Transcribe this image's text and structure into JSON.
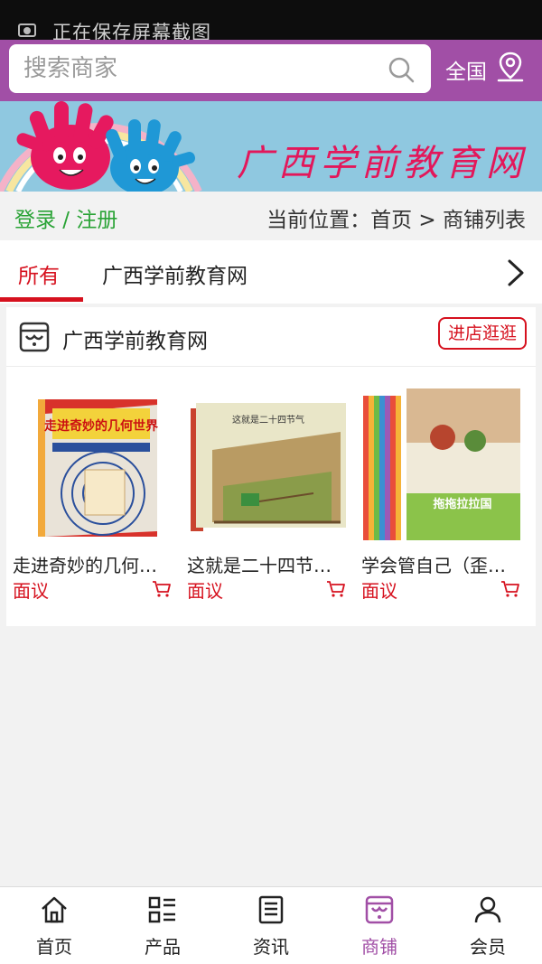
{
  "status_bar": {
    "message": "正在保存屏幕截图"
  },
  "search": {
    "placeholder": "搜索商家",
    "region_label": "全国"
  },
  "banner": {
    "title": "广西学前教育网"
  },
  "auth": {
    "login": "登录",
    "separator": " / ",
    "register": "注册"
  },
  "breadcrumb": "当前位置：首页 > 商铺列表",
  "tabs": [
    {
      "label": "所有",
      "active": true
    },
    {
      "label": "广西学前教育网",
      "active": false
    }
  ],
  "shop": {
    "name": "广西学前教育网",
    "visit_label": "进店逛逛",
    "products": [
      {
        "name": "走进奇妙的几何…",
        "price": "面议",
        "cover_title": "走进奇妙的几何世界"
      },
      {
        "name": "这就是二十四节…",
        "price": "面议",
        "cover_title": "这就是二十四节气"
      },
      {
        "name": "学会管自己（歪…",
        "price": "面议",
        "cover_title": "拖拖拉拉国"
      }
    ]
  },
  "bottom_nav": [
    {
      "label": "首页",
      "icon": "home-icon",
      "active": false
    },
    {
      "label": "产品",
      "icon": "grid-list-icon",
      "active": false
    },
    {
      "label": "资讯",
      "icon": "news-icon",
      "active": false
    },
    {
      "label": "商铺",
      "icon": "store-icon",
      "active": true
    },
    {
      "label": "会员",
      "icon": "user-icon",
      "active": false
    }
  ],
  "colors": {
    "brand": "#a14fa6",
    "accent_red": "#d6111e",
    "login_green": "#2aa336"
  }
}
